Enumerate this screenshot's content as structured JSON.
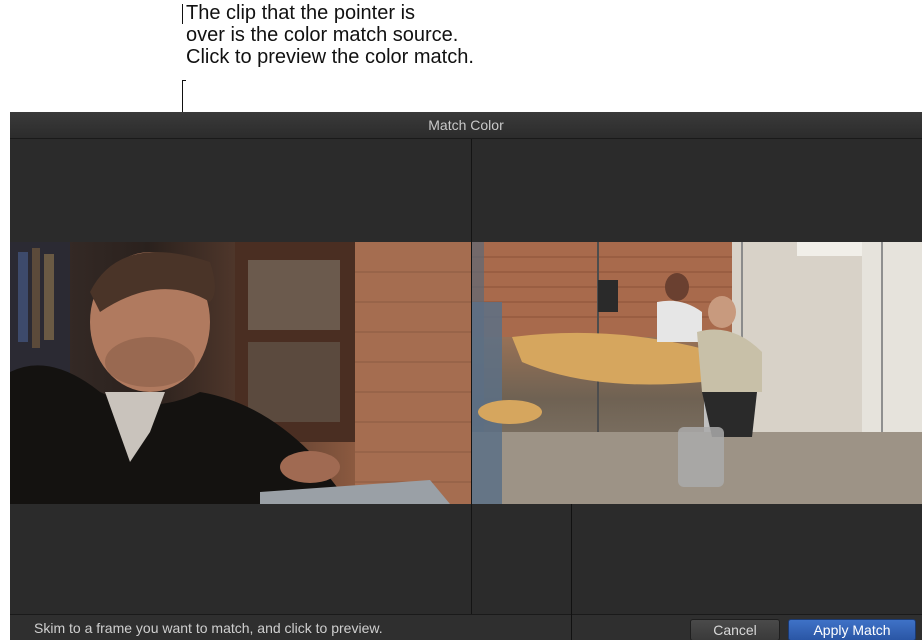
{
  "callout": {
    "lines": [
      "The clip that the pointer is",
      "over is the color match source.",
      "Click to preview the color match."
    ]
  },
  "window": {
    "title": "Match Color"
  },
  "footer": {
    "status_text": "Skim to a frame you want to match, and click to preview.",
    "cancel_label": "Cancel",
    "apply_label": "Apply Match"
  },
  "colors": {
    "window_bg": "#2a2a2a",
    "accent": "#2a56a5"
  }
}
